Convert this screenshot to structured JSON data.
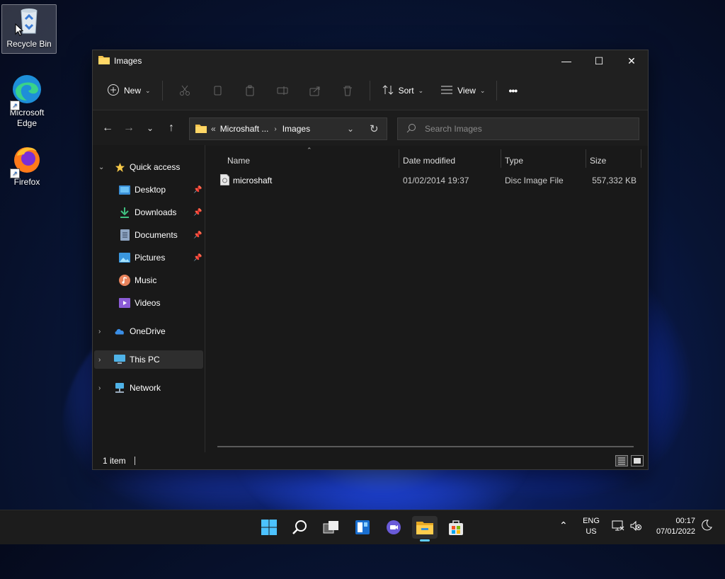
{
  "desktop": {
    "icons": [
      {
        "label": "Recycle Bin"
      },
      {
        "label": "Microsoft Edge"
      },
      {
        "label": "Firefox"
      }
    ]
  },
  "window": {
    "title": "Images",
    "controls": {
      "minimize": "—",
      "maximize": "☐",
      "close": "✕"
    }
  },
  "toolbar": {
    "new_label": "New",
    "sort_label": "Sort",
    "view_label": "View",
    "more_label": "•••"
  },
  "address": {
    "overflow": "«",
    "segments": [
      "Microshaft ...",
      "Images"
    ]
  },
  "search": {
    "placeholder": "Search Images"
  },
  "sidebar": {
    "quick_access": "Quick access",
    "items": [
      {
        "label": "Desktop",
        "pinned": true
      },
      {
        "label": "Downloads",
        "pinned": true
      },
      {
        "label": "Documents",
        "pinned": true
      },
      {
        "label": "Pictures",
        "pinned": true
      },
      {
        "label": "Music",
        "pinned": false
      },
      {
        "label": "Videos",
        "pinned": false
      }
    ],
    "onedrive": "OneDrive",
    "this_pc": "This PC",
    "network": "Network"
  },
  "columns": {
    "name": "Name",
    "date": "Date modified",
    "type": "Type",
    "size": "Size"
  },
  "files": [
    {
      "name": "microshaft",
      "date": "01/02/2014 19:37",
      "type": "Disc Image File",
      "size": "557,332 KB"
    }
  ],
  "status": {
    "count": "1 item"
  },
  "tray": {
    "lang_top": "ENG",
    "lang_bottom": "US",
    "time": "00:17",
    "date": "07/01/2022"
  },
  "colors": {
    "accent": "#60cdff",
    "folder": "#f4c34e"
  }
}
